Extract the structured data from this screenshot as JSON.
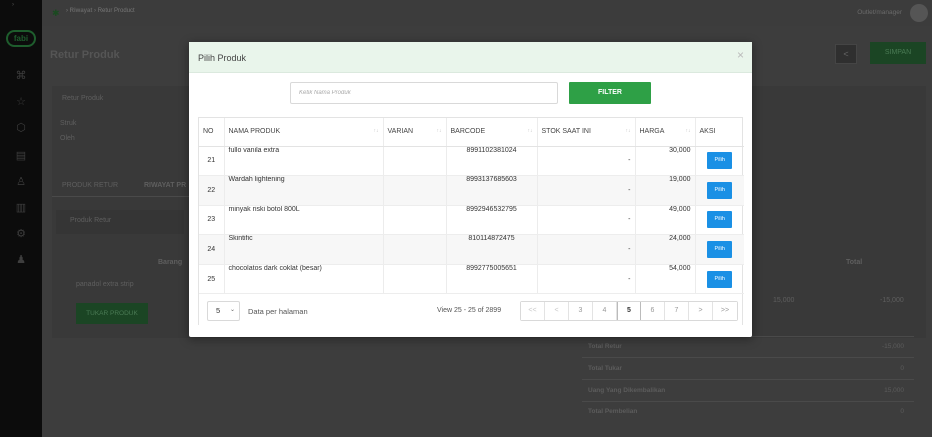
{
  "app": {
    "logo_text": "fabi",
    "breadcrumb": {
      "parent": "Riwayat",
      "current": "Retur Product"
    },
    "user_name": "Outlet/manager",
    "page_title": "Retur Produk",
    "back_label": "<",
    "save_label": "SIMPAN"
  },
  "background": {
    "section_label": "Retur Produk",
    "struk_label": "Struk",
    "oleh_label": "Oleh",
    "tab_retur": "PRODUK RETUR",
    "tab_riwayat": "RIWAYAT PR",
    "strip_label": "Produk Retur",
    "col_barang": "Barang",
    "col_total": "Total",
    "item_name": "panadol extra strip",
    "item_price": "15,000",
    "item_total": "-15,000",
    "tukar_label": "TUKAR PRODUK",
    "summary": [
      {
        "label": "Total Retur",
        "value": "-15,000"
      },
      {
        "label": "Total Tukar",
        "value": "0"
      },
      {
        "label": "Uang Yang Dikembalikan",
        "value": "15,000"
      },
      {
        "label": "Total Pembelian",
        "value": "0"
      }
    ]
  },
  "modal": {
    "title": "Pilih Produk",
    "close": "×",
    "search_placeholder": "Ketik Nama Produk",
    "filter_label": "FILTER",
    "columns": {
      "no": "NO",
      "nama": "NAMA PRODUK",
      "varian": "VARIAN",
      "barcode": "BARCODE",
      "stok": "STOK SAAT INI",
      "harga": "HARGA",
      "aksi": "AKSI"
    },
    "rows": [
      {
        "no": "21",
        "nama": "fullo vanila extra",
        "varian": "",
        "barcode": "8991102381024",
        "stok": "-",
        "harga": "30,000",
        "aksi": "Pilih"
      },
      {
        "no": "22",
        "nama": "Wardah lightening",
        "varian": "",
        "barcode": "8993137685603",
        "stok": "-",
        "harga": "19,000",
        "aksi": "Pilih"
      },
      {
        "no": "23",
        "nama": "minyak riski botol 800L",
        "varian": "",
        "barcode": "8992946532795",
        "stok": "-",
        "harga": "49,000",
        "aksi": "Pilih"
      },
      {
        "no": "24",
        "nama": "Skintific",
        "varian": "",
        "barcode": "810114872475",
        "stok": "-",
        "harga": "24,000",
        "aksi": "Pilih"
      },
      {
        "no": "25",
        "nama": "chocolatos dark coklat (besar)",
        "varian": "",
        "barcode": "8992775005651",
        "stok": "-",
        "harga": "54,000",
        "aksi": "Pilih"
      }
    ],
    "per_page": "5",
    "per_page_label": "Data per halaman",
    "view_info": "View 25 - 25 of 2899",
    "pager": {
      "first": "<<",
      "prev": "<",
      "pages": [
        "3",
        "4",
        "5",
        "6",
        "7"
      ],
      "active": "5",
      "next": ">",
      "last": ">>"
    }
  }
}
